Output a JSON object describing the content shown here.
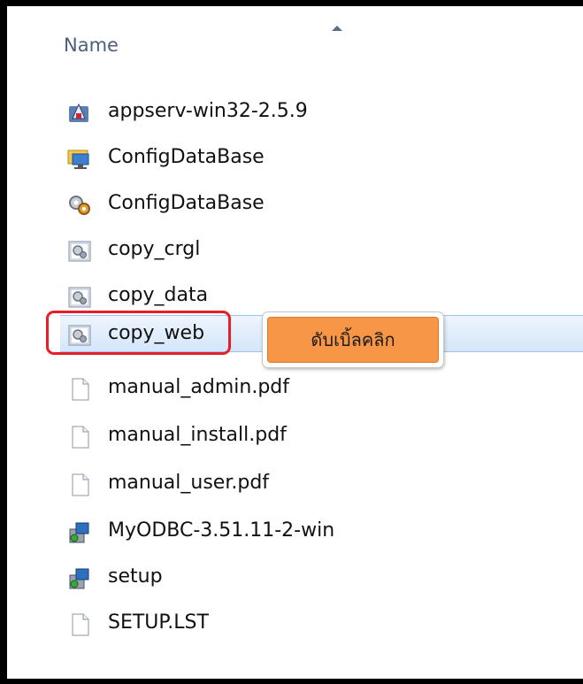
{
  "header": {
    "column_name": "Name"
  },
  "files": [
    {
      "name": "appserv-win32-2.5.9",
      "icon": "installer-icon"
    },
    {
      "name": "ConfigDataBase",
      "icon": "monitor-folder-icon"
    },
    {
      "name": "ConfigDataBase",
      "icon": "gear-shortcut-icon"
    },
    {
      "name": "copy_crgl",
      "icon": "batch-file-icon"
    },
    {
      "name": "copy_data",
      "icon": "batch-file-icon"
    },
    {
      "name": "copy_web",
      "icon": "batch-file-icon",
      "selected": true
    },
    {
      "name": "manual_admin.pdf",
      "icon": "document-icon"
    },
    {
      "name": "manual_install.pdf",
      "icon": "document-icon"
    },
    {
      "name": "manual_user.pdf",
      "icon": "document-icon"
    },
    {
      "name": "MyODBC-3.51.11-2-win",
      "icon": "setup-icon"
    },
    {
      "name": "setup",
      "icon": "setup-icon"
    },
    {
      "name": "SETUP.LST",
      "icon": "document-icon"
    }
  ],
  "annotation": {
    "callout_text": "ดับเบิ้ลคลิก",
    "highlight_color": "#e61e26",
    "callout_color": "#f79646"
  },
  "colors": {
    "selection": "#d4e6fa",
    "header_text": "#4d5f78"
  }
}
